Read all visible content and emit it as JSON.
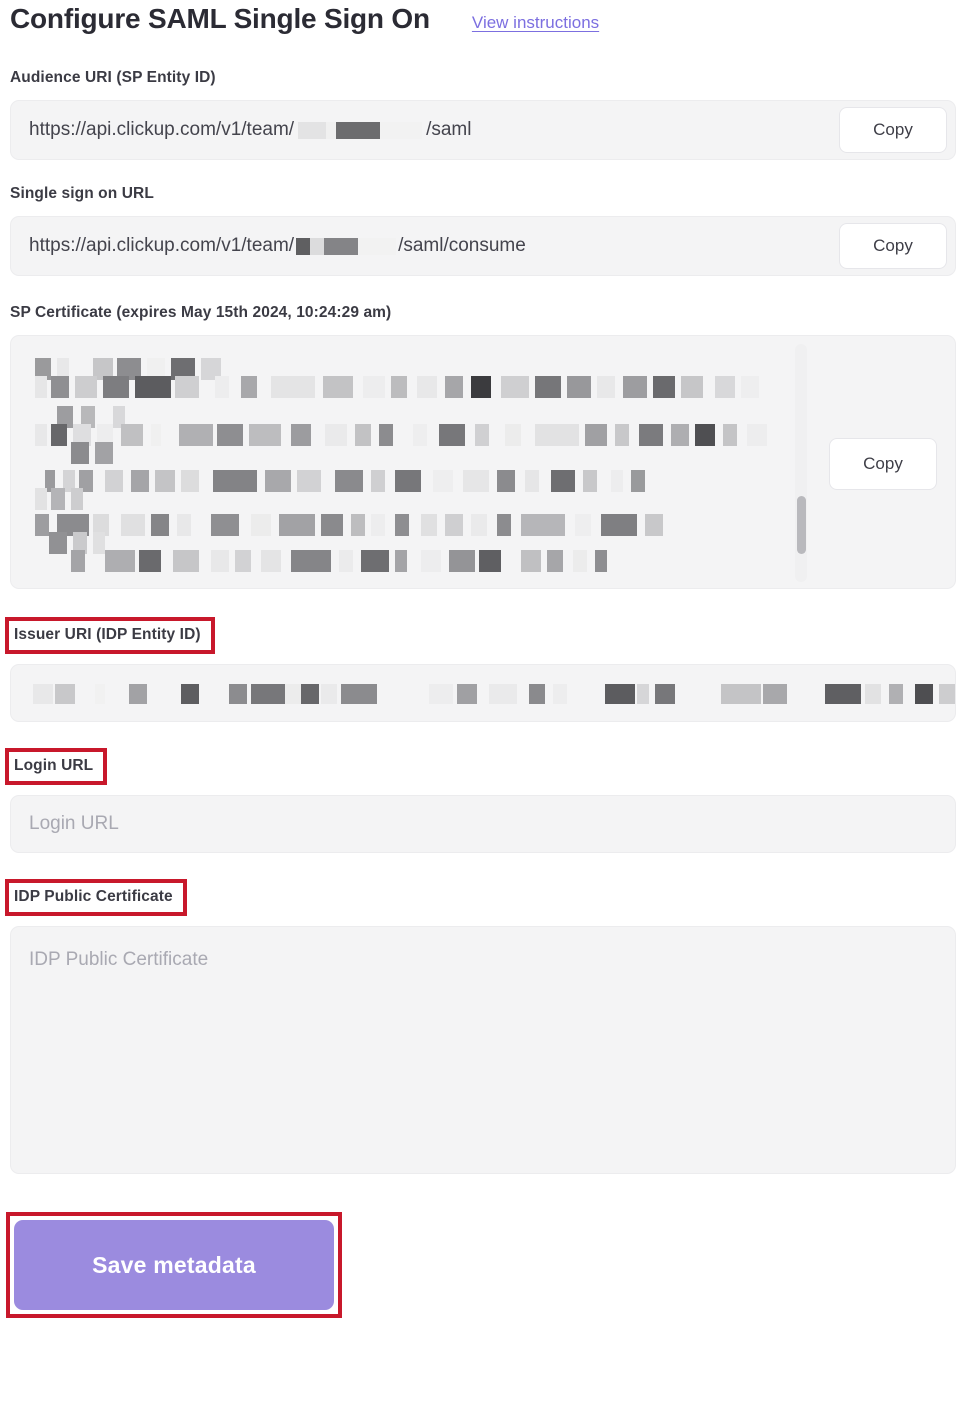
{
  "header": {
    "title": "Configure SAML Single Sign On",
    "instructions_link": "View instructions"
  },
  "fields": {
    "audience_uri": {
      "label": "Audience URI (SP Entity ID)",
      "value_prefix": "https://api.clickup.com/v1/team/",
      "value_redacted": true,
      "value_suffix": "/saml",
      "copy_label": "Copy"
    },
    "sso_url": {
      "label": "Single sign on URL",
      "value_prefix": "https://api.clickup.com/v1/team/",
      "value_redacted": true,
      "value_suffix": "/saml/consume",
      "copy_label": "Copy"
    },
    "sp_certificate": {
      "label": "SP Certificate (expires May 15th 2024, 10:24:29 am)",
      "value_redacted": true,
      "copy_label": "Copy"
    },
    "issuer_uri": {
      "label": "Issuer URI (IDP Entity ID)",
      "highlighted": true,
      "value_redacted": true
    },
    "login_url": {
      "label": "Login URL",
      "highlighted": true,
      "value": "",
      "placeholder": "Login URL"
    },
    "idp_public_certificate": {
      "label": "IDP Public Certificate",
      "highlighted": true,
      "value": "",
      "placeholder": "IDP Public Certificate"
    }
  },
  "actions": {
    "save_label": "Save metadata",
    "save_highlighted": true
  },
  "colors": {
    "accent_purple": "#9b8bdf",
    "link_purple": "#7c6fe0",
    "annotation_red": "#c8182b",
    "field_background": "#f4f4f5",
    "text_dark": "#3b3b44",
    "placeholder_gray": "#a9a9b2"
  }
}
